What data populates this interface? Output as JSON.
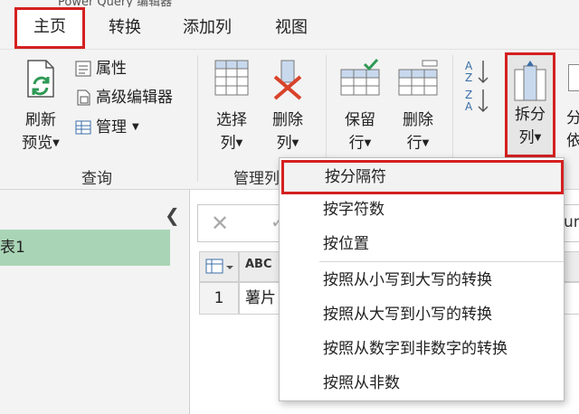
{
  "window": {
    "title_fragment": "Power Query 编辑器"
  },
  "tabs": [
    {
      "label": "主页",
      "active": true
    },
    {
      "label": "转换",
      "active": false
    },
    {
      "label": "添加列",
      "active": false
    },
    {
      "label": "视图",
      "active": false
    }
  ],
  "ribbon": {
    "refresh": {
      "line1": "刷新",
      "line2": "预览"
    },
    "properties": "属性",
    "advanced_editor": "高级编辑器",
    "manage": "管理",
    "query_group": "查询",
    "choose_cols": {
      "line1": "选择",
      "line2": "列"
    },
    "remove_cols": {
      "line1": "删除",
      "line2": "列"
    },
    "manage_cols_group": "管理列",
    "keep_rows": {
      "line1": "保留",
      "line2": "行"
    },
    "remove_rows": {
      "line1": "删除",
      "line2": "行"
    },
    "split": {
      "line1": "拆分",
      "line2": "列"
    },
    "partial_next_1": "分",
    "partial_next_2": "依"
  },
  "left_pane": {
    "query_name": "表1"
  },
  "formula_partial": "um",
  "grid": {
    "row_number": "1",
    "cell_value": "薯片",
    "col_type": "ABC"
  },
  "split_menu": {
    "items": [
      "按分隔符",
      "按字符数",
      "按位置",
      "按照从小写到大写的转换",
      "按照从大写到小写的转换",
      "按照从数字到非数字的转换",
      "按照从非数"
    ]
  },
  "colors": {
    "highlight_border": "#d42020",
    "query_selected": "#a9d5b6"
  }
}
